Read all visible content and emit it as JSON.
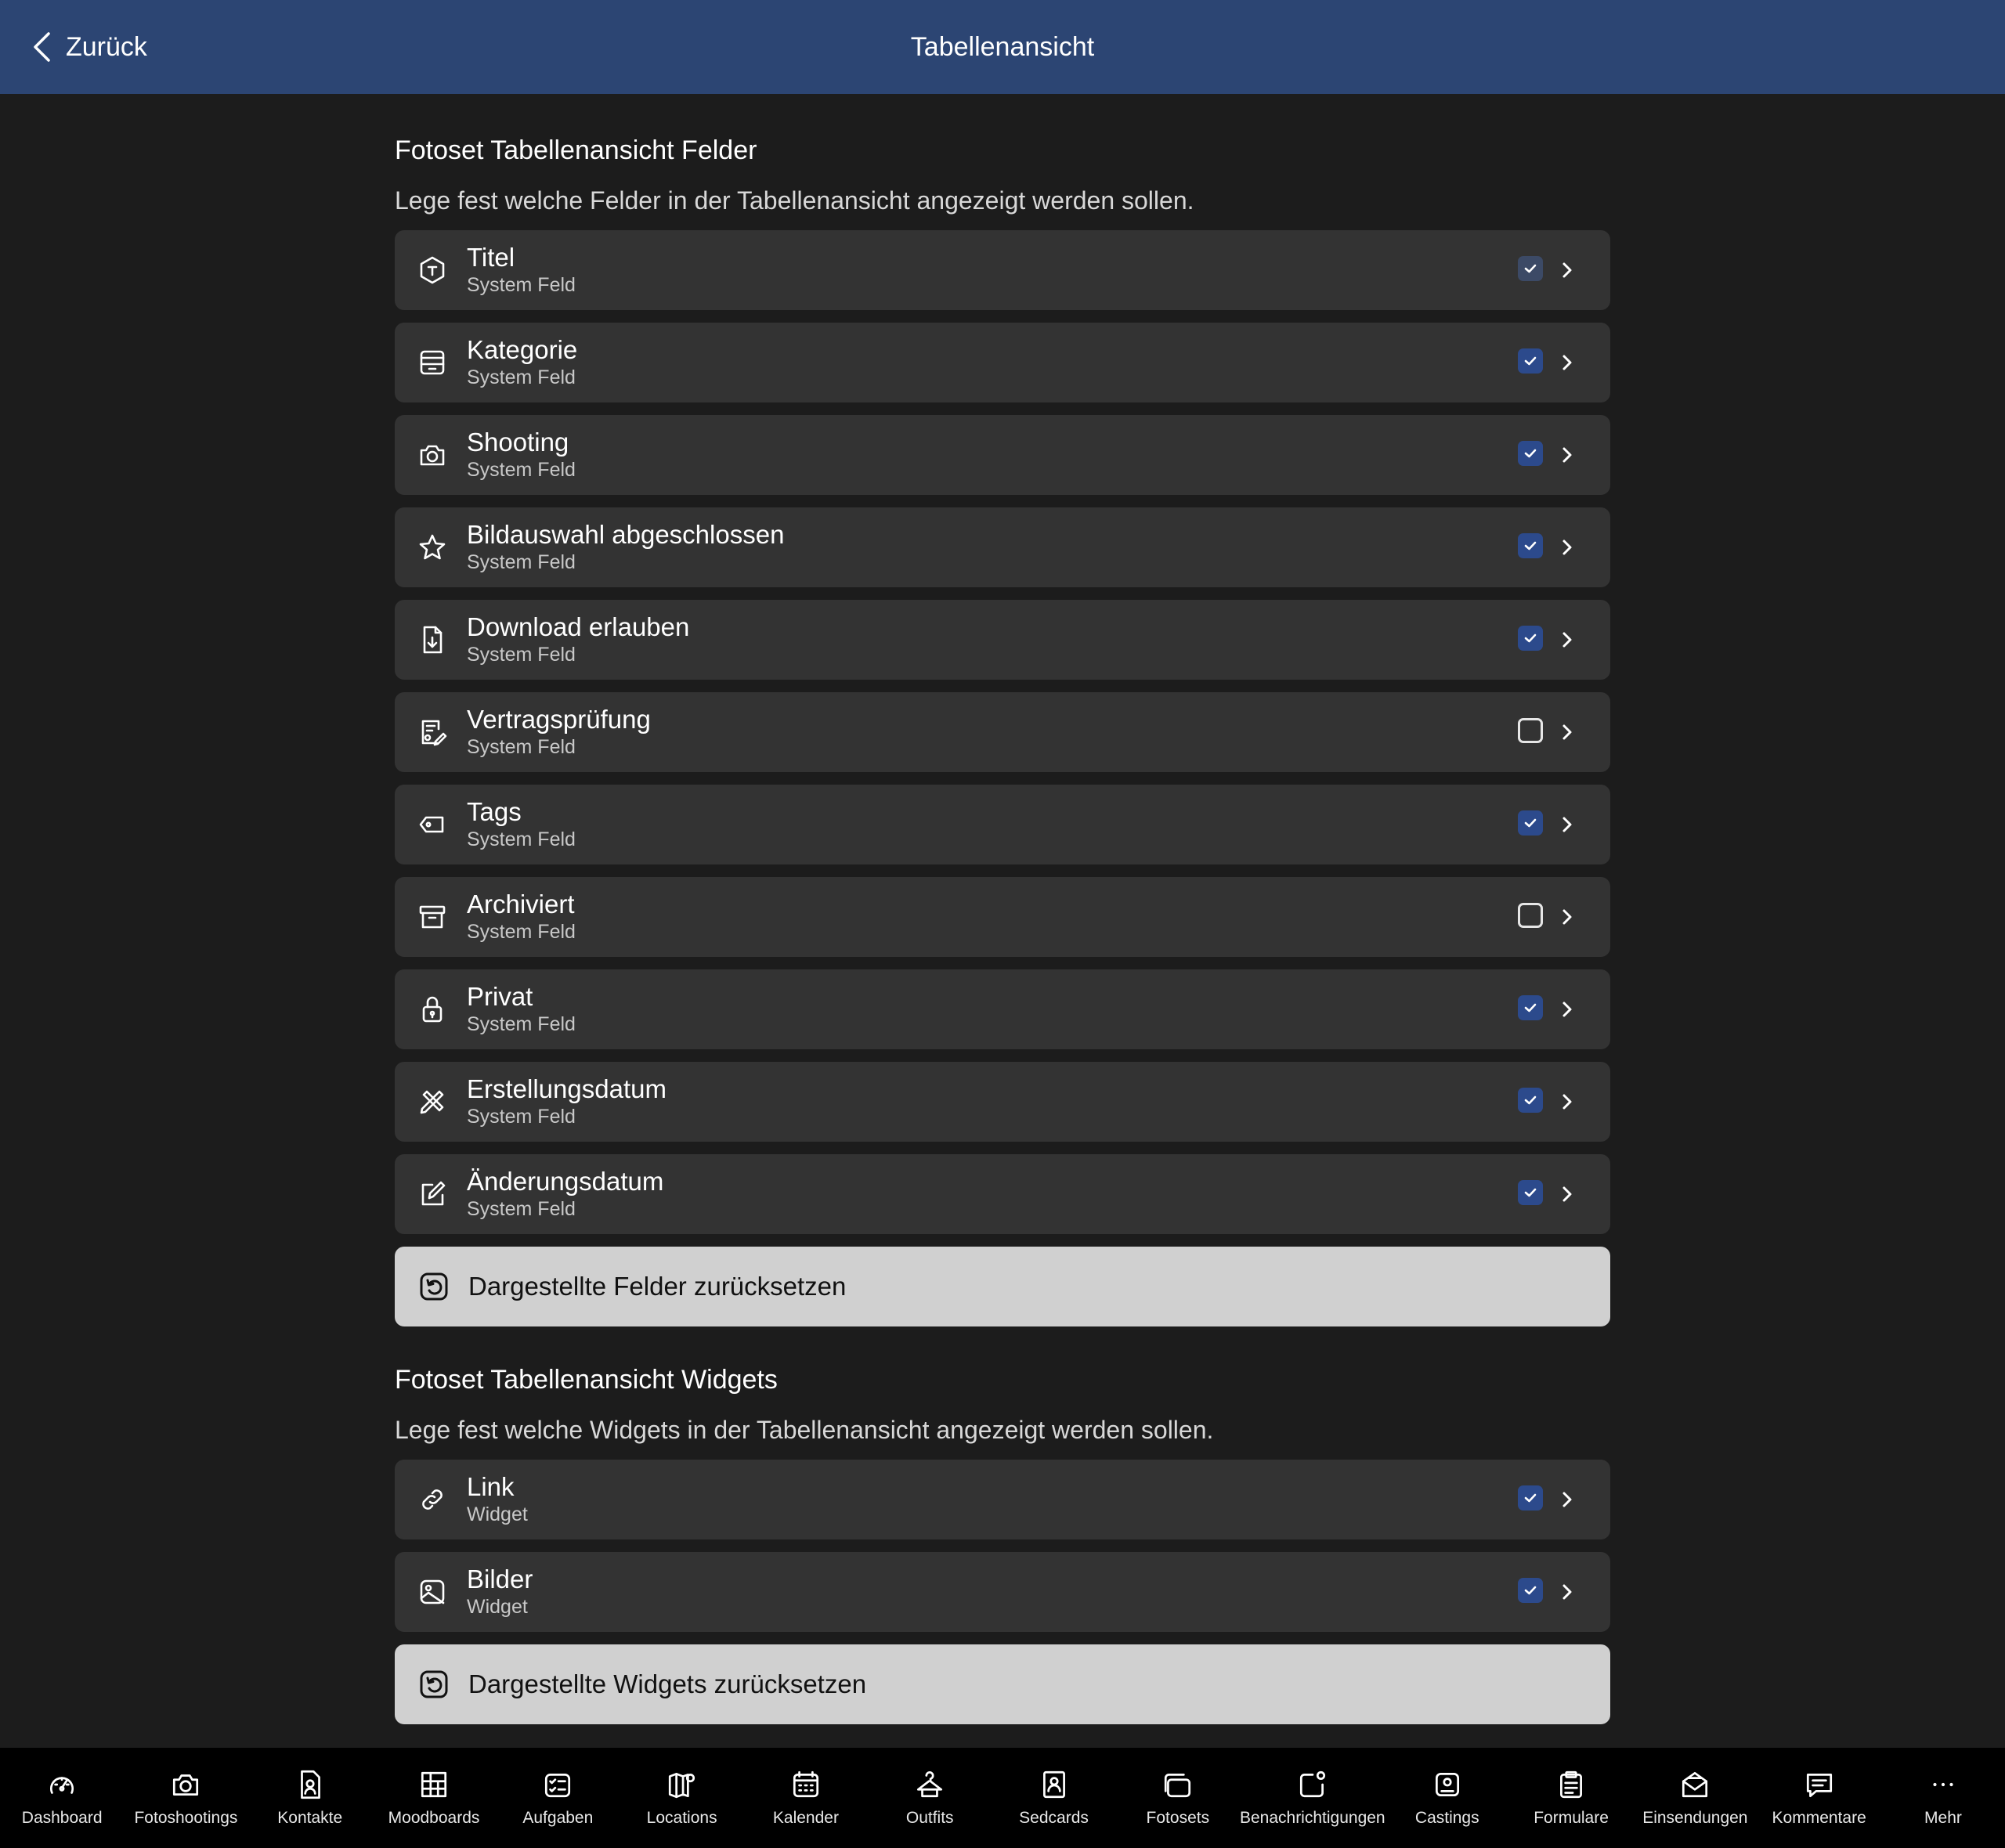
{
  "header": {
    "back_label": "Zurück",
    "title": "Tabellenansicht"
  },
  "fields_section": {
    "title": "Fotoset Tabellenansicht Felder",
    "description": "Lege fest welche Felder in der Tabellenansicht angezeigt werden sollen.",
    "items": [
      {
        "label": "Titel",
        "subtitle": "System Feld",
        "icon": "tag-hexagon-icon",
        "checked": true,
        "locked": true
      },
      {
        "label": "Kategorie",
        "subtitle": "System Feld",
        "icon": "tray-icon",
        "checked": true
      },
      {
        "label": "Shooting",
        "subtitle": "System Feld",
        "icon": "camera-icon",
        "checked": true
      },
      {
        "label": "Bildauswahl abgeschlossen",
        "subtitle": "System Feld",
        "icon": "star-icon",
        "checked": true
      },
      {
        "label": "Download erlauben",
        "subtitle": "System Feld",
        "icon": "file-download-icon",
        "checked": true
      },
      {
        "label": "Vertragsprüfung",
        "subtitle": "System Feld",
        "icon": "contract-edit-icon",
        "checked": false
      },
      {
        "label": "Tags",
        "subtitle": "System Feld",
        "icon": "tag-icon",
        "checked": true
      },
      {
        "label": "Archiviert",
        "subtitle": "System Feld",
        "icon": "archive-icon",
        "checked": false
      },
      {
        "label": "Privat",
        "subtitle": "System Feld",
        "icon": "lock-icon",
        "checked": true
      },
      {
        "label": "Erstellungsdatum",
        "subtitle": "System Feld",
        "icon": "pencil-ruler-icon",
        "checked": true
      },
      {
        "label": "Änderungsdatum",
        "subtitle": "System Feld",
        "icon": "edit-icon",
        "checked": true
      }
    ],
    "reset_label": "Dargestellte Felder zurücksetzen"
  },
  "widgets_section": {
    "title": "Fotoset Tabellenansicht Widgets",
    "description": "Lege fest welche Widgets in der Tabellenansicht angezeigt werden sollen.",
    "items": [
      {
        "label": "Link",
        "subtitle": "Widget",
        "icon": "link-icon",
        "checked": true
      },
      {
        "label": "Bilder",
        "subtitle": "Widget",
        "icon": "image-icon",
        "checked": true
      }
    ],
    "reset_label": "Dargestellte Widgets zurücksetzen"
  },
  "tabbar": [
    {
      "label": "Dashboard",
      "icon": "speedometer-icon"
    },
    {
      "label": "Fotoshootings",
      "icon": "camera-icon"
    },
    {
      "label": "Kontakte",
      "icon": "contact-icon"
    },
    {
      "label": "Moodboards",
      "icon": "grid-icon"
    },
    {
      "label": "Aufgaben",
      "icon": "checklist-icon"
    },
    {
      "label": "Locations",
      "icon": "map-icon"
    },
    {
      "label": "Kalender",
      "icon": "calendar-icon"
    },
    {
      "label": "Outfits",
      "icon": "hanger-icon"
    },
    {
      "label": "Sedcards",
      "icon": "portrait-icon"
    },
    {
      "label": "Fotosets",
      "icon": "stack-icon"
    },
    {
      "label": "Benachrichtigungen",
      "icon": "notification-icon"
    },
    {
      "label": "Castings",
      "icon": "badge-icon"
    },
    {
      "label": "Formulare",
      "icon": "clipboard-icon"
    },
    {
      "label": "Einsendungen",
      "icon": "envelope-icon"
    },
    {
      "label": "Kommentare",
      "icon": "comment-icon"
    },
    {
      "label": "Mehr",
      "icon": "more-icon"
    }
  ],
  "colors": {
    "header": "#2c4573",
    "background": "#1c1c1c",
    "row": "#333333",
    "checkbox": "#2c4a8c",
    "reset": "#d0d0d0"
  }
}
